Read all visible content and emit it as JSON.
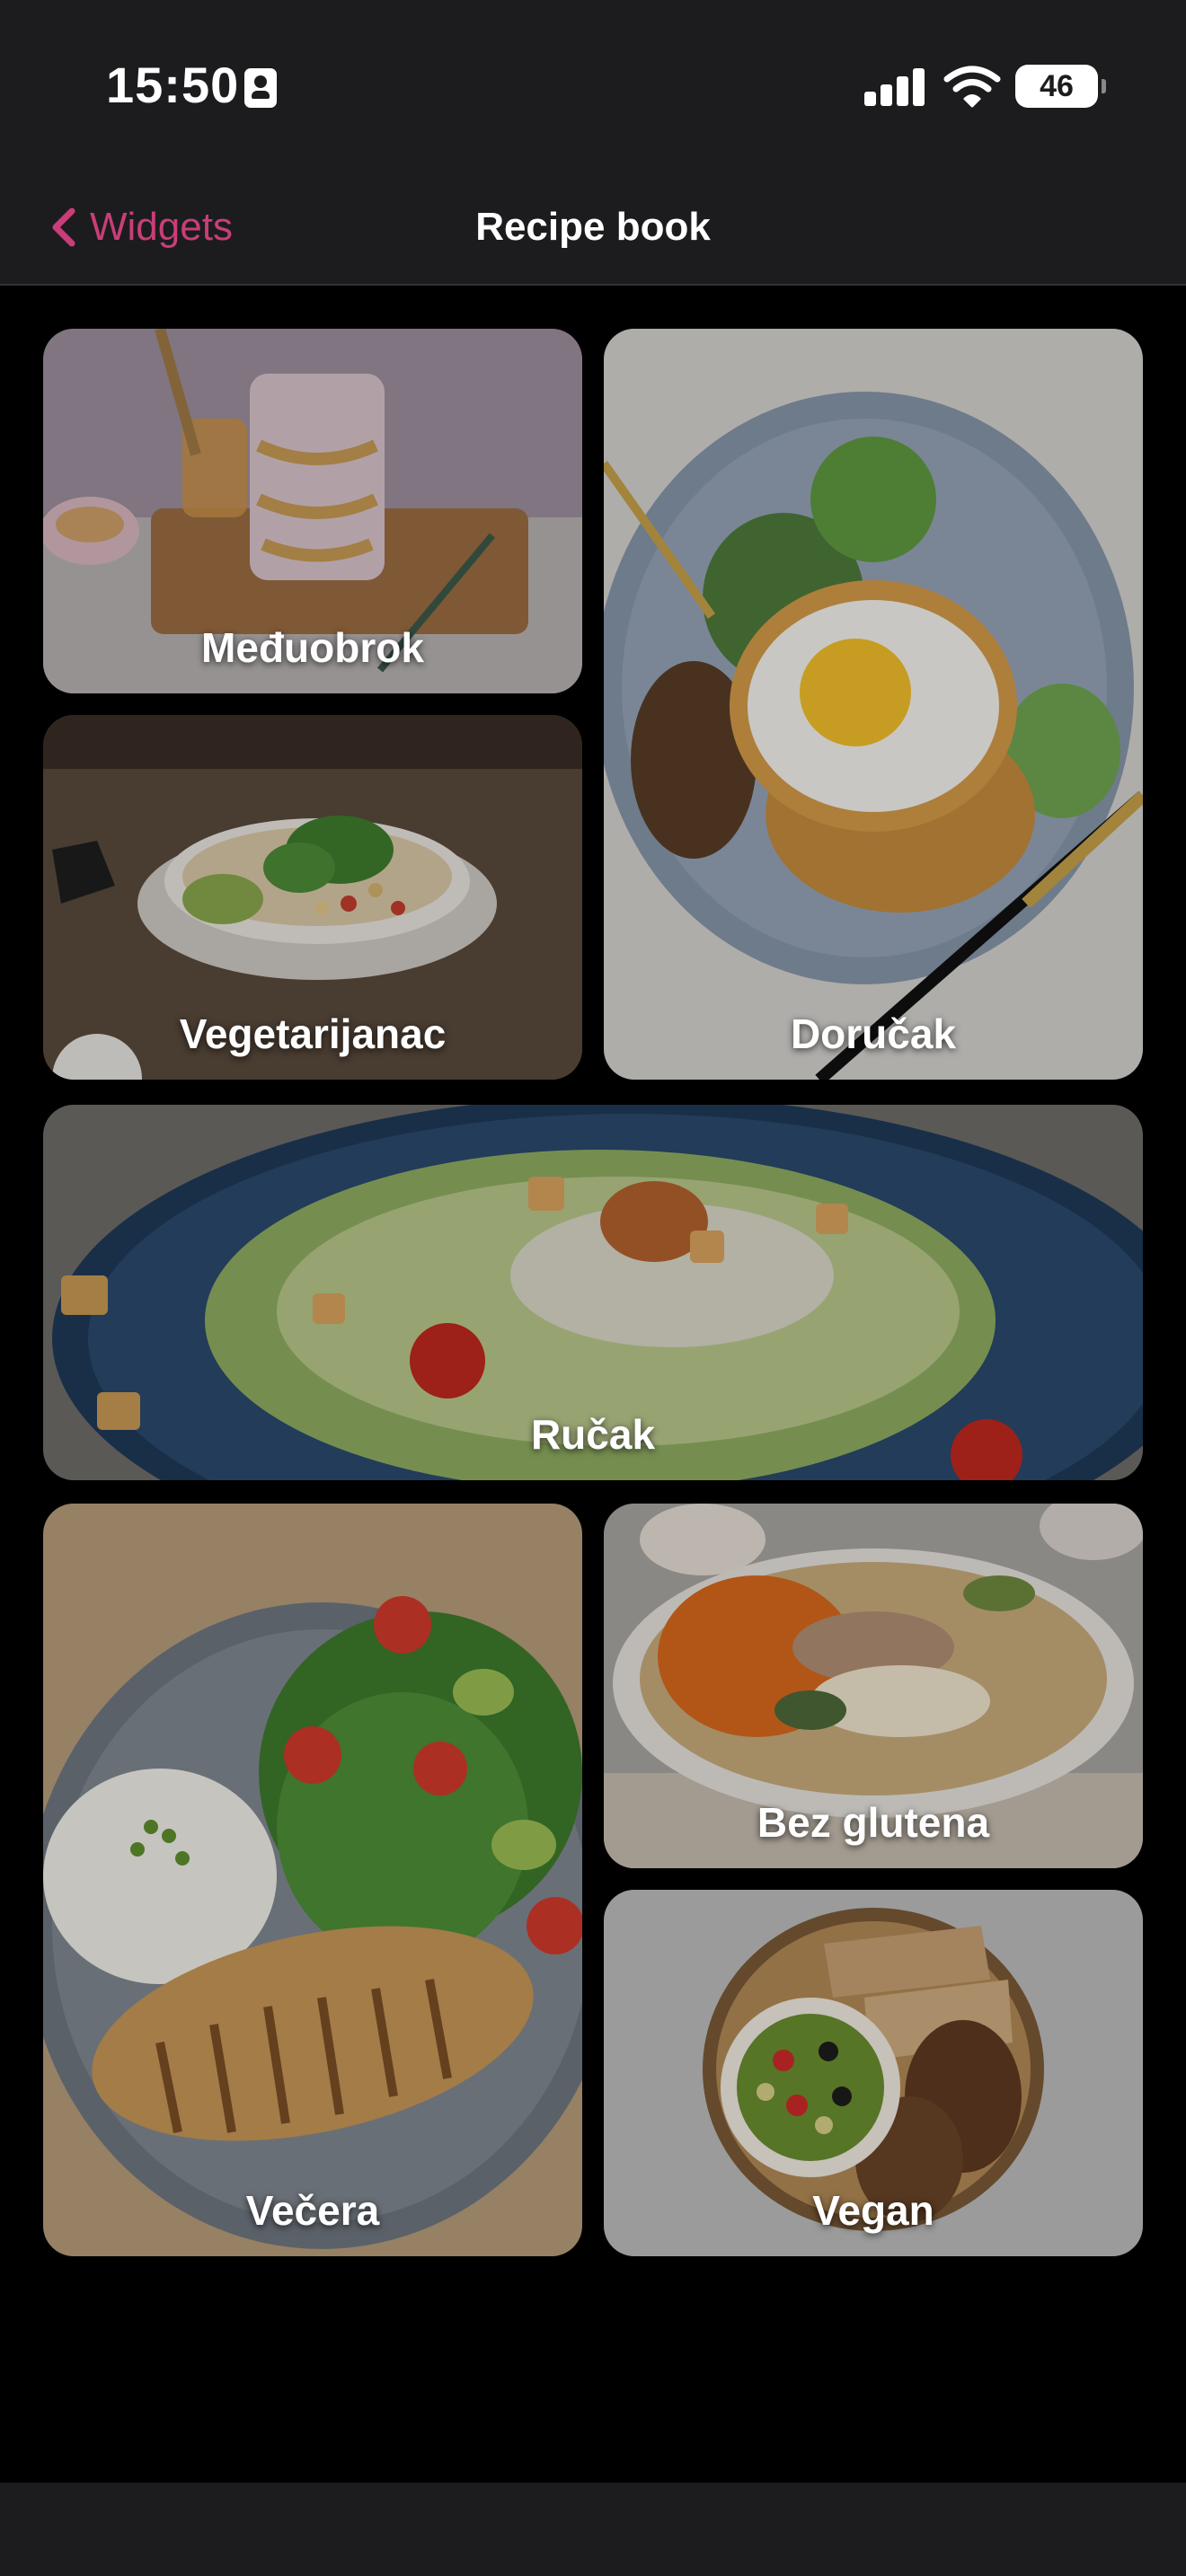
{
  "status_bar": {
    "time": "15:50",
    "battery": "46",
    "icons": [
      "id-card-icon",
      "signal-icon",
      "wifi-icon",
      "battery-icon"
    ]
  },
  "nav": {
    "back_label": "Widgets",
    "title": "Recipe book",
    "back_icon": "chevron-left-icon"
  },
  "colors": {
    "accent": "#c93e78",
    "background": "#000000",
    "bar": "#1c1c1e"
  },
  "categories": [
    {
      "label": "Međuobrok"
    },
    {
      "label": "Doručak"
    },
    {
      "label": "Vegetarijanac"
    },
    {
      "label": "Ručak"
    },
    {
      "label": "Večera"
    },
    {
      "label": "Bez glutena"
    },
    {
      "label": "Vegan"
    }
  ]
}
